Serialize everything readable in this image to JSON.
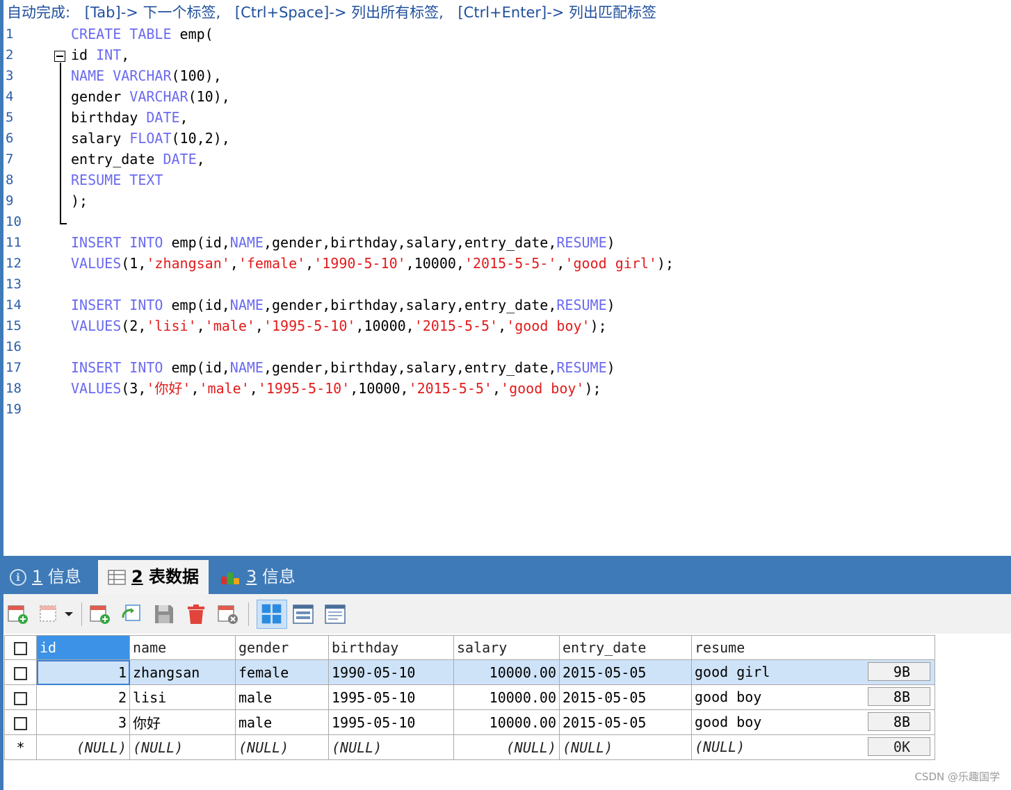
{
  "hint": {
    "prefix": "自动完成:",
    "tab": "[Tab]-> 下一个标签,",
    "ctrl_space": "[Ctrl+Space]-> 列出所有标签,",
    "ctrl_enter": "[Ctrl+Enter]-> 列出匹配标签"
  },
  "editor": {
    "line_numbers": [
      "1",
      "2",
      "3",
      "4",
      "5",
      "6",
      "7",
      "8",
      "9",
      "10",
      "11",
      "12",
      "13",
      "14",
      "15",
      "16",
      "17",
      "18",
      "19"
    ],
    "lines": [
      [
        {
          "t": "CREATE TABLE",
          "c": "kw"
        },
        {
          "t": " emp(",
          "c": "pl"
        }
      ],
      [
        {
          "t": "id ",
          "c": "pl"
        },
        {
          "t": "INT",
          "c": "kw"
        },
        {
          "t": ",",
          "c": "pl"
        }
      ],
      [
        {
          "t": "NAME VARCHAR",
          "c": "kw"
        },
        {
          "t": "(100),",
          "c": "pl"
        }
      ],
      [
        {
          "t": "gender ",
          "c": "pl"
        },
        {
          "t": "VARCHAR",
          "c": "kw"
        },
        {
          "t": "(10),",
          "c": "pl"
        }
      ],
      [
        {
          "t": "birthday ",
          "c": "pl"
        },
        {
          "t": "DATE",
          "c": "kw"
        },
        {
          "t": ",",
          "c": "pl"
        }
      ],
      [
        {
          "t": "salary ",
          "c": "pl"
        },
        {
          "t": "FLOAT",
          "c": "kw"
        },
        {
          "t": "(10,2),",
          "c": "pl"
        }
      ],
      [
        {
          "t": "entry_date ",
          "c": "pl"
        },
        {
          "t": "DATE",
          "c": "kw"
        },
        {
          "t": ",",
          "c": "pl"
        }
      ],
      [
        {
          "t": "RESUME TEXT",
          "c": "kw"
        }
      ],
      [
        {
          "t": ");",
          "c": "pl"
        }
      ],
      [],
      [
        {
          "t": "INSERT INTO",
          "c": "kw"
        },
        {
          "t": " emp(id,",
          "c": "pl"
        },
        {
          "t": "NAME",
          "c": "kw"
        },
        {
          "t": ",gender,birthday,salary,entry_date,",
          "c": "pl"
        },
        {
          "t": "RESUME",
          "c": "kw"
        },
        {
          "t": ")",
          "c": "pl"
        }
      ],
      [
        {
          "t": "VALUES",
          "c": "kw"
        },
        {
          "t": "(1,",
          "c": "pl"
        },
        {
          "t": "'zhangsan'",
          "c": "str"
        },
        {
          "t": ",",
          "c": "pl"
        },
        {
          "t": "'female'",
          "c": "str"
        },
        {
          "t": ",",
          "c": "pl"
        },
        {
          "t": "'1990-5-10'",
          "c": "str"
        },
        {
          "t": ",10000,",
          "c": "pl"
        },
        {
          "t": "'2015-5-5-'",
          "c": "str"
        },
        {
          "t": ",",
          "c": "pl"
        },
        {
          "t": "'good girl'",
          "c": "str"
        },
        {
          "t": ");",
          "c": "pl"
        }
      ],
      [],
      [
        {
          "t": "INSERT INTO",
          "c": "kw"
        },
        {
          "t": " emp(id,",
          "c": "pl"
        },
        {
          "t": "NAME",
          "c": "kw"
        },
        {
          "t": ",gender,birthday,salary,entry_date,",
          "c": "pl"
        },
        {
          "t": "RESUME",
          "c": "kw"
        },
        {
          "t": ")",
          "c": "pl"
        }
      ],
      [
        {
          "t": "VALUES",
          "c": "kw"
        },
        {
          "t": "(2,",
          "c": "pl"
        },
        {
          "t": "'lisi'",
          "c": "str"
        },
        {
          "t": ",",
          "c": "pl"
        },
        {
          "t": "'male'",
          "c": "str"
        },
        {
          "t": ",",
          "c": "pl"
        },
        {
          "t": "'1995-5-10'",
          "c": "str"
        },
        {
          "t": ",10000,",
          "c": "pl"
        },
        {
          "t": "'2015-5-5'",
          "c": "str"
        },
        {
          "t": ",",
          "c": "pl"
        },
        {
          "t": "'good boy'",
          "c": "str"
        },
        {
          "t": ");",
          "c": "pl"
        }
      ],
      [],
      [
        {
          "t": "INSERT INTO",
          "c": "kw"
        },
        {
          "t": " emp(id,",
          "c": "pl"
        },
        {
          "t": "NAME",
          "c": "kw"
        },
        {
          "t": ",gender,birthday,salary,entry_date,",
          "c": "pl"
        },
        {
          "t": "RESUME",
          "c": "kw"
        },
        {
          "t": ")",
          "c": "pl"
        }
      ],
      [
        {
          "t": "VALUES",
          "c": "kw"
        },
        {
          "t": "(3,",
          "c": "pl"
        },
        {
          "t": "'你好'",
          "c": "str"
        },
        {
          "t": ",",
          "c": "pl"
        },
        {
          "t": "'male'",
          "c": "str"
        },
        {
          "t": ",",
          "c": "pl"
        },
        {
          "t": "'1995-5-10'",
          "c": "str"
        },
        {
          "t": ",10000,",
          "c": "pl"
        },
        {
          "t": "'2015-5-5'",
          "c": "str"
        },
        {
          "t": ",",
          "c": "pl"
        },
        {
          "t": "'good boy'",
          "c": "str"
        },
        {
          "t": ");",
          "c": "pl"
        }
      ],
      []
    ]
  },
  "tabs": [
    {
      "num": "1",
      "label": " 信息",
      "icon": "info-icon"
    },
    {
      "num": "2",
      "label": " 表数据",
      "icon": "table-icon"
    },
    {
      "num": "3",
      "label": " 信息",
      "icon": "chart-icon"
    }
  ],
  "toolbar_icons": [
    "add-row-icon",
    "duplicate-row-icon",
    "insert-row-icon",
    "refresh-icon",
    "save-icon",
    "delete-icon",
    "cancel-icon",
    "grid-view-icon",
    "form-view-icon",
    "text-view-icon"
  ],
  "grid": {
    "columns": [
      "id",
      "name",
      "gender",
      "birthday",
      "salary",
      "entry_date",
      "resume"
    ],
    "rows": [
      [
        "1",
        "zhangsan",
        "female",
        "1990-05-10",
        "10000.00",
        "2015-05-05",
        "good girl",
        "9B"
      ],
      [
        "2",
        "lisi",
        "male",
        "1995-05-10",
        "10000.00",
        "2015-05-05",
        "good boy",
        "8B"
      ],
      [
        "3",
        "你好",
        "male",
        "1995-05-10",
        "10000.00",
        "2015-05-05",
        "good boy",
        "8B"
      ]
    ],
    "new_row_marker": "*",
    "null_text": "(NULL)",
    "new_row_size": "0K"
  },
  "watermark": "CSDN @乐趣国学"
}
